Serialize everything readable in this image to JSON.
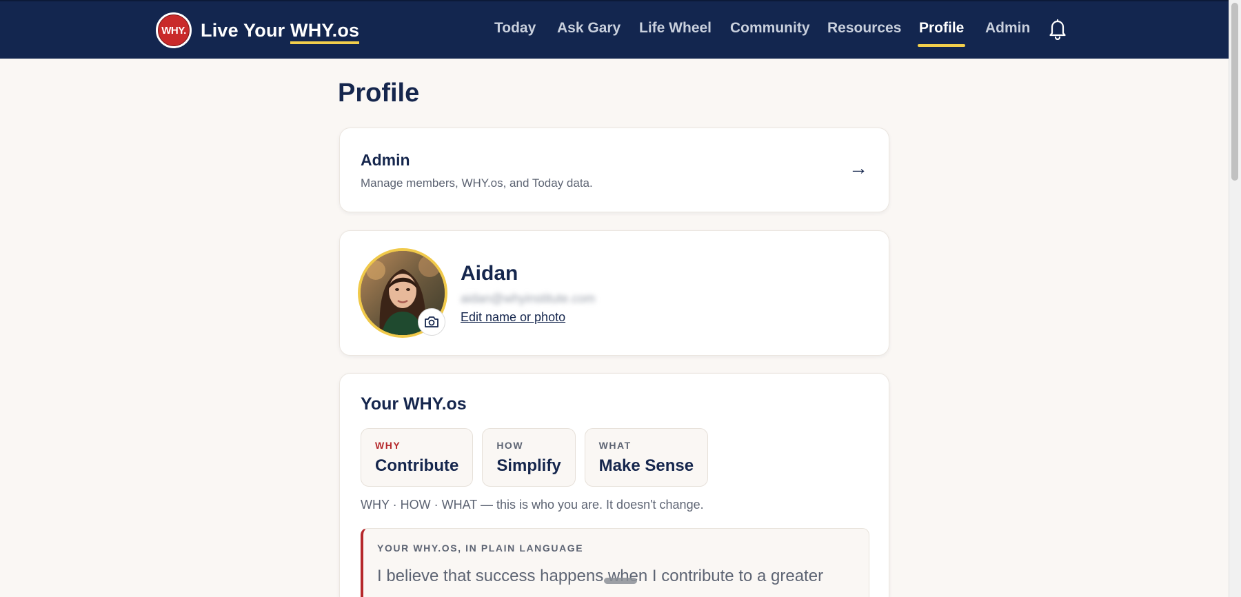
{
  "brand": {
    "logo_text": "WHY.",
    "name_prefix": "Live Your ",
    "name_highlight": "WHY.os"
  },
  "nav": {
    "items": [
      {
        "label": "Today",
        "active": false
      },
      {
        "label": "Ask Gary",
        "active": false
      },
      {
        "label": "Life Wheel",
        "active": false
      },
      {
        "label": "Community",
        "active": false
      },
      {
        "label": "Resources",
        "active": false
      },
      {
        "label": "Profile",
        "active": true
      },
      {
        "label": "Admin",
        "active": false
      }
    ],
    "notification_icon": "bell-icon"
  },
  "page": {
    "title": "Profile"
  },
  "admin_card": {
    "title": "Admin",
    "description": "Manage members, WHY.os, and Today data.",
    "arrow": "→"
  },
  "profile": {
    "name": "Aidan",
    "email": "aidan@whyinstitute.com",
    "edit_link": "Edit name or photo",
    "camera_icon": "camera-icon"
  },
  "why_os": {
    "title": "Your WHY.os",
    "chips": [
      {
        "label": "WHY",
        "value": "Contribute"
      },
      {
        "label": "HOW",
        "value": "Simplify"
      },
      {
        "label": "WHAT",
        "value": "Make Sense"
      }
    ],
    "caption": "WHY · HOW · WHAT — this is who you are. It doesn't change.",
    "plain_label": "YOUR WHY.OS, IN PLAIN LANGUAGE",
    "plain_text": "I believe that success happens when I contribute to a greater cause."
  },
  "colors": {
    "navbar": "#13264f",
    "accent_yellow": "#f2cf4c",
    "brand_red": "#c92a2a",
    "page_bg": "#faf7f4"
  }
}
